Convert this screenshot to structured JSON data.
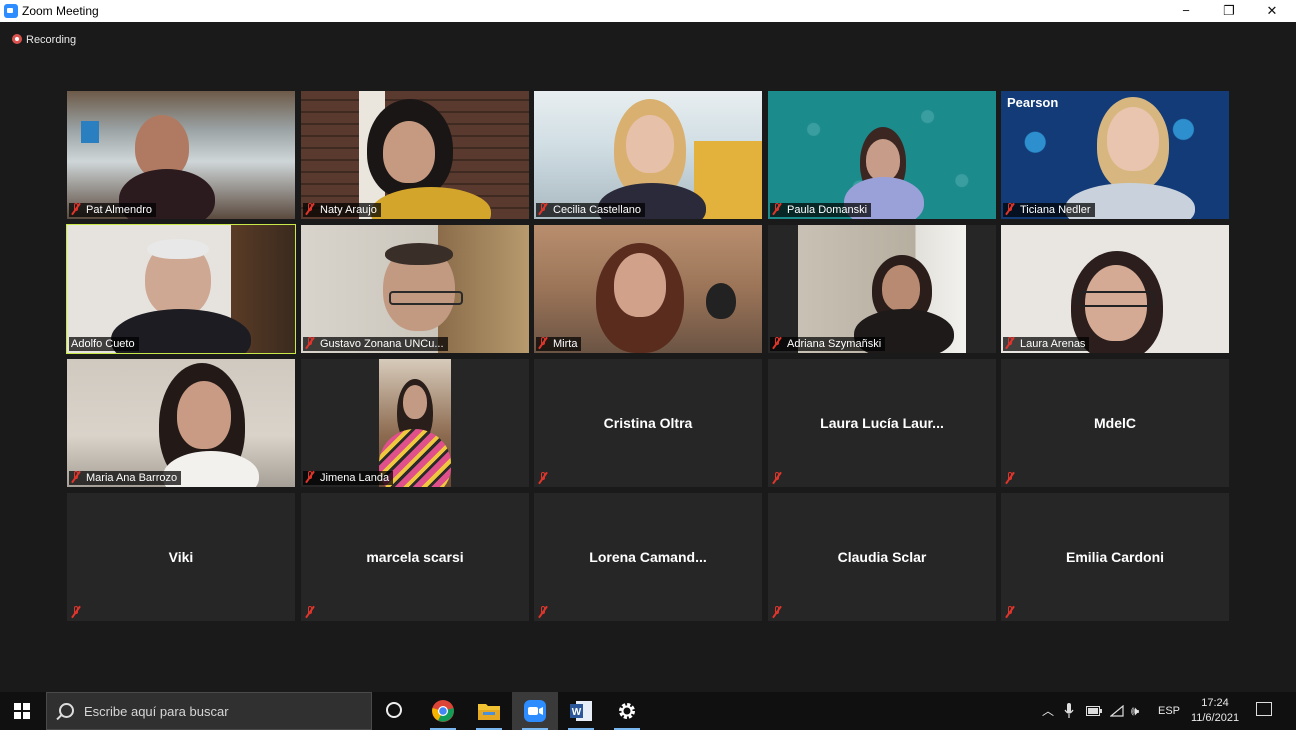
{
  "window": {
    "title": "Zoom Meeting",
    "controls": {
      "minimize": "−",
      "maximize": "❐",
      "close": "✕"
    }
  },
  "recording": {
    "label": "Recording"
  },
  "participants": [
    {
      "name": "Pat Almendro",
      "video": true
    },
    {
      "name": "Naty Araujo",
      "video": true
    },
    {
      "name": "Cecilia Castellano",
      "video": true
    },
    {
      "name": "Paula Domanski",
      "video": true
    },
    {
      "name": "Ticiana Nedler",
      "video": true,
      "background_text": "Pearson"
    },
    {
      "name": "Adolfo Cueto",
      "video": true,
      "active_speaker": true
    },
    {
      "name": "Gustavo Zonana UNCu...",
      "video": true
    },
    {
      "name": "Mirta",
      "video": true
    },
    {
      "name": "Adriana Szymañski",
      "video": true
    },
    {
      "name": "Laura Arenas",
      "video": true
    },
    {
      "name": "Maria Ana Barrozo",
      "video": true
    },
    {
      "name": "Jimena Landa",
      "video": true
    },
    {
      "name": "Cristina Oltra",
      "video": false
    },
    {
      "name": "Laura  Lucía  Laur...",
      "video": false
    },
    {
      "name": "MdelC",
      "video": false
    },
    {
      "name": "Viki",
      "video": false
    },
    {
      "name": "marcela scarsi",
      "video": false
    },
    {
      "name": "Lorena  Camand...",
      "video": false
    },
    {
      "name": "Claudia Sclar",
      "video": false
    },
    {
      "name": "Emilia Cardoni",
      "video": false
    }
  ],
  "taskbar": {
    "search_placeholder": "Escribe aquí para buscar",
    "apps": [
      "chrome-icon",
      "file-explorer-icon",
      "zoom-icon",
      "word-icon",
      "settings-icon"
    ],
    "tray": {
      "language": "ESP",
      "time": "17:24",
      "date": "11/6/2021"
    }
  }
}
